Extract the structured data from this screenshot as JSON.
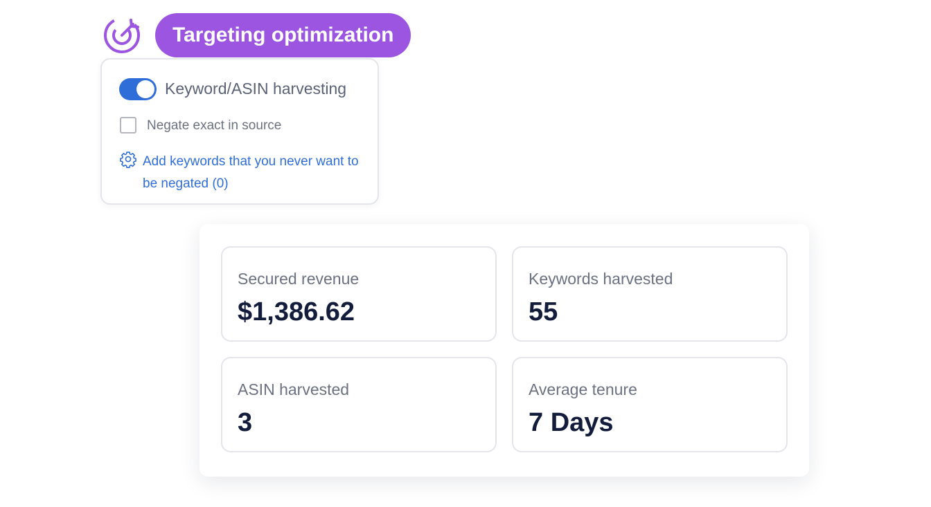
{
  "header": {
    "title": "Targeting optimization",
    "icon": "target-icon",
    "accent_color": "#9b55e0"
  },
  "settings": {
    "toggle": {
      "label": "Keyword/ASIN harvesting",
      "checked": true,
      "color": "#2f6ed8"
    },
    "checkbox": {
      "label": "Negate exact in source",
      "checked": false
    },
    "link": {
      "icon": "gear-icon",
      "text": "Add keywords that you never want to be negated (0)"
    }
  },
  "stats": [
    {
      "label": "Secured revenue",
      "value": "$1,386.62"
    },
    {
      "label": "Keywords harvested",
      "value": "55"
    },
    {
      "label": "ASIN harvested",
      "value": "3"
    },
    {
      "label": "Average tenure",
      "value": "7 Days"
    }
  ]
}
